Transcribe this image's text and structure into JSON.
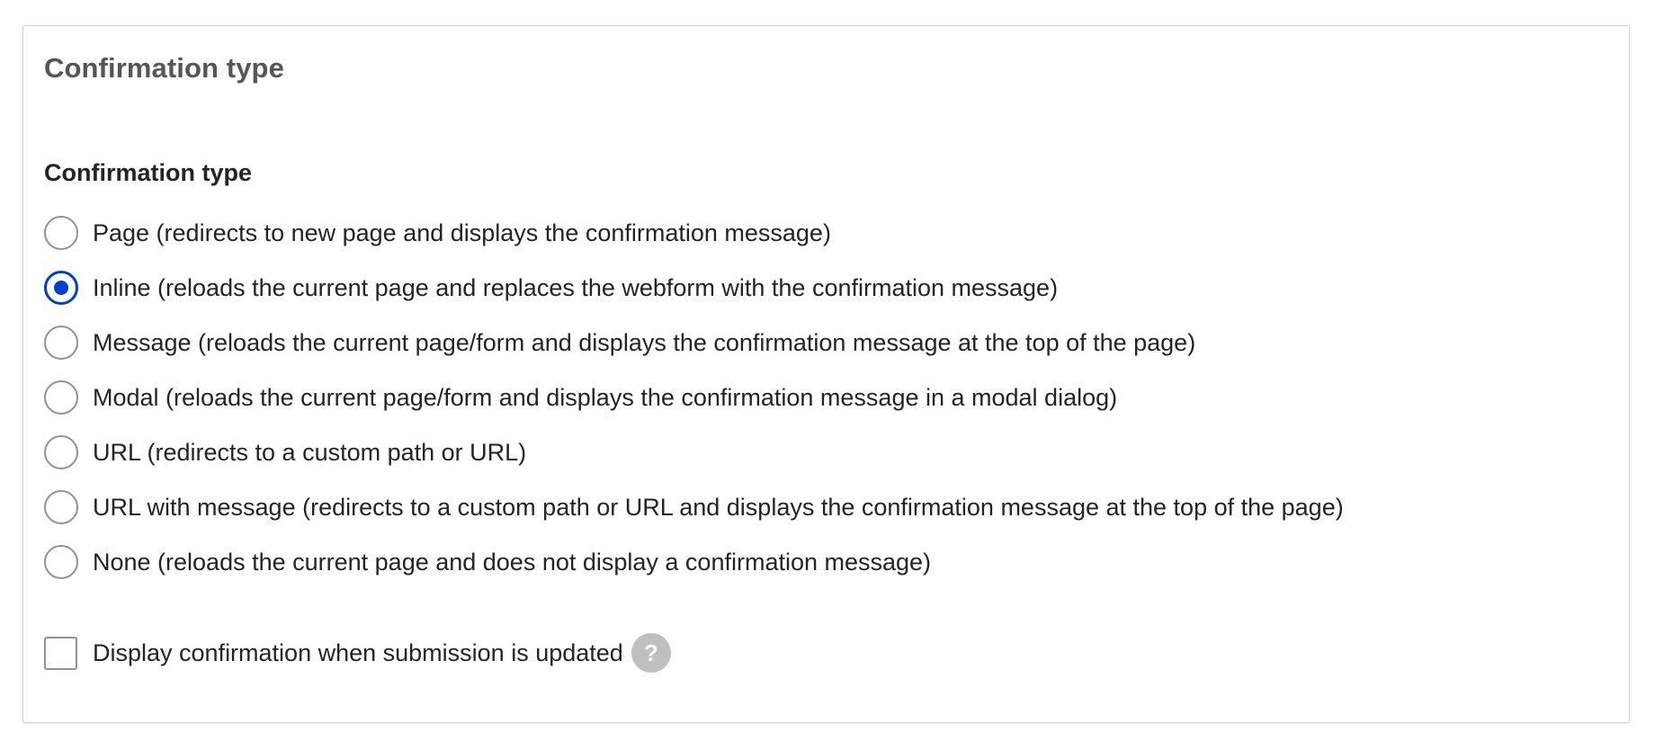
{
  "section": {
    "title": "Confirmation type"
  },
  "field": {
    "label": "Confirmation type",
    "selected_index": 1,
    "options": [
      {
        "label": "Page (redirects to new page and displays the confirmation message)"
      },
      {
        "label": "Inline (reloads the current page and replaces the webform with the confirmation message)"
      },
      {
        "label": "Message (reloads the current page/form and displays the confirmation message at the top of the page)"
      },
      {
        "label": "Modal (reloads the current page/form and displays the confirmation message in a modal dialog)"
      },
      {
        "label": "URL (redirects to a custom path or URL)"
      },
      {
        "label": "URL with message (redirects to a custom path or URL and displays the confirmation message at the top of the page)"
      },
      {
        "label": "None (reloads the current page and does not display a confirmation message)"
      }
    ]
  },
  "update_checkbox": {
    "label": "Display confirmation when submission is updated",
    "checked": false,
    "help_glyph": "?"
  },
  "colors": {
    "accent": "#003ecc",
    "border": "#d3d4d9",
    "help_bg": "#bfbfbf",
    "title": "#55565b",
    "text": "#232429"
  }
}
